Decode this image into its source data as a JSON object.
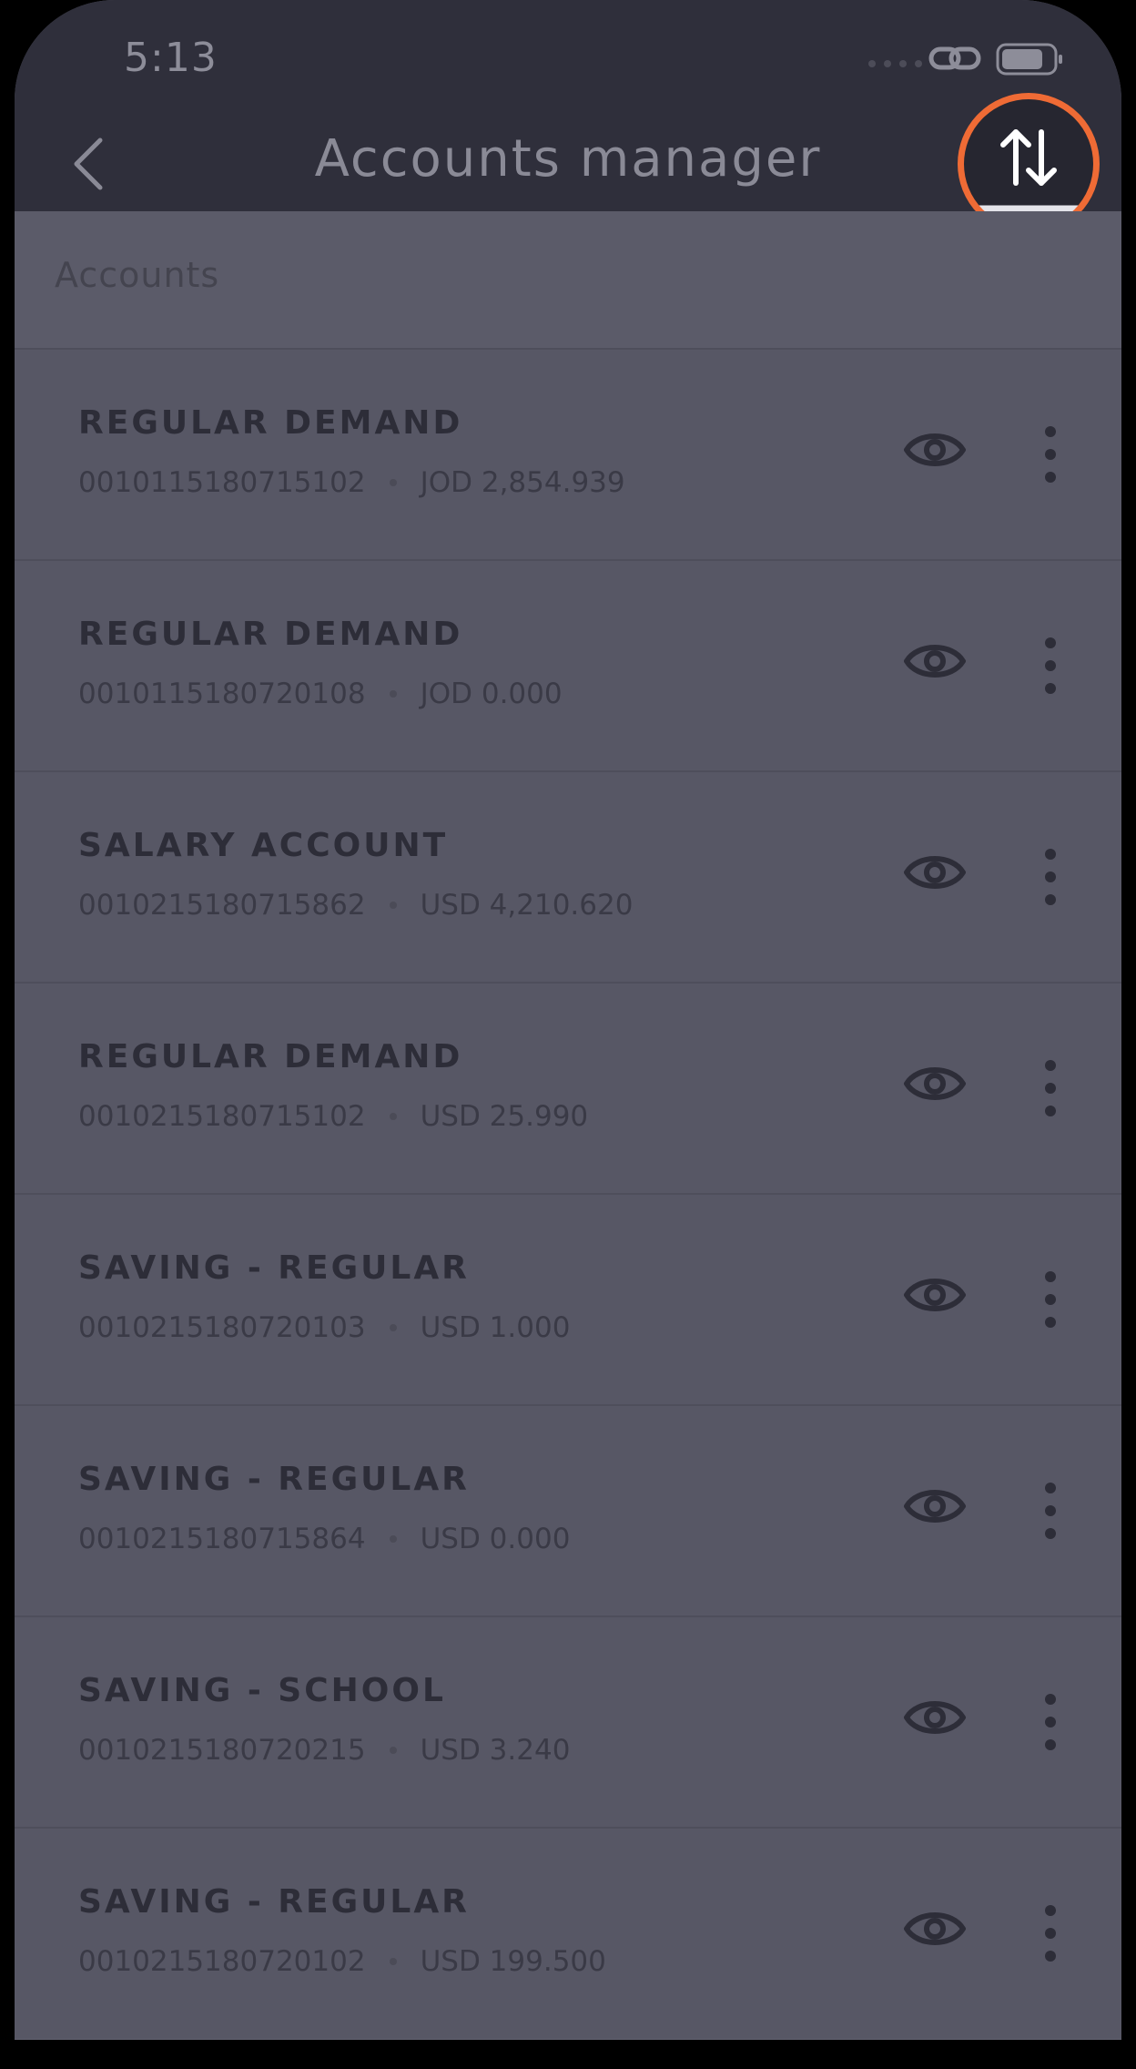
{
  "status_bar": {
    "time": "5:13"
  },
  "header": {
    "title": "Accounts manager"
  },
  "section": {
    "title": "Accounts"
  },
  "colors": {
    "accent_ring": "#ef6b35",
    "header_bg": "#2f2f3b",
    "list_bg": "#575765"
  },
  "icons": {
    "back": "chevron-left-icon",
    "sort": "sort-arrows-icon",
    "visibility": "eye-icon",
    "menu": "more-vertical-icon"
  },
  "accounts": [
    {
      "name": "REGULAR DEMAND",
      "number": "0010115180715102",
      "balance": "JOD 2,854.939"
    },
    {
      "name": "REGULAR DEMAND",
      "number": "0010115180720108",
      "balance": "JOD 0.000"
    },
    {
      "name": "SALARY ACCOUNT",
      "number": "0010215180715862",
      "balance": "USD 4,210.620"
    },
    {
      "name": "REGULAR DEMAND",
      "number": "0010215180715102",
      "balance": "USD 25.990"
    },
    {
      "name": "SAVING - REGULAR",
      "number": "0010215180720103",
      "balance": "USD 1.000"
    },
    {
      "name": "SAVING - REGULAR",
      "number": "0010215180715864",
      "balance": "USD 0.000"
    },
    {
      "name": "SAVING - SCHOOL",
      "number": "0010215180720215",
      "balance": "USD 3.240"
    },
    {
      "name": "SAVING - REGULAR",
      "number": "0010215180720102",
      "balance": "USD 199.500"
    }
  ]
}
